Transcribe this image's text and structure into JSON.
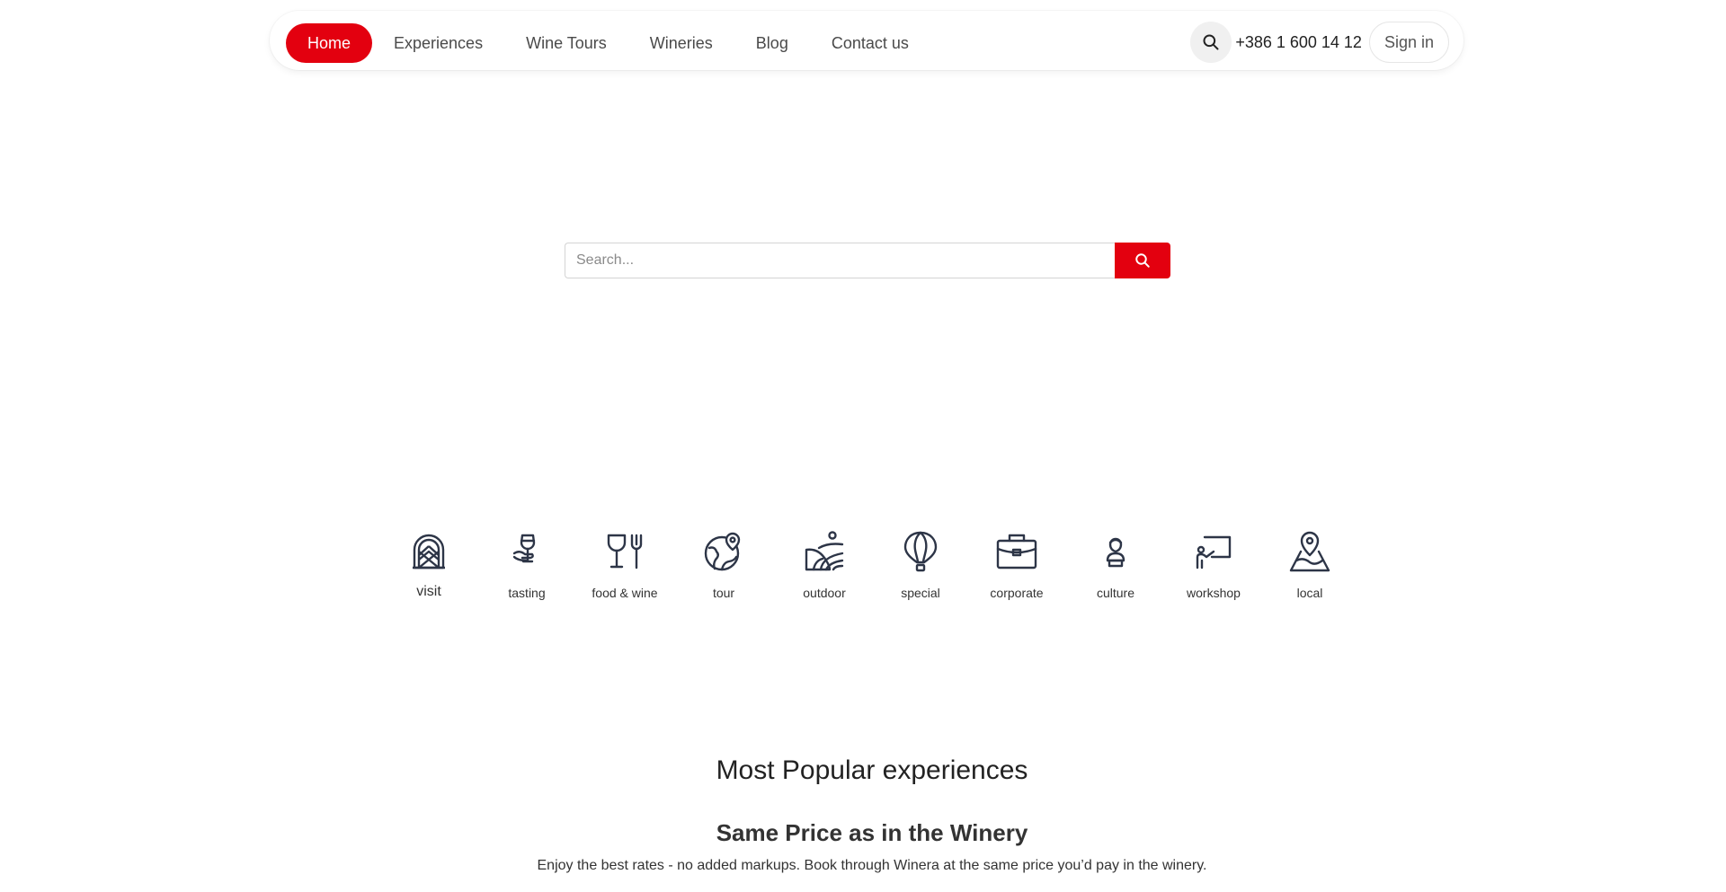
{
  "nav": {
    "links": [
      "Home",
      "Experiences",
      "Wine Tours",
      "Wineries",
      "Blog",
      "Contact us"
    ],
    "active": "Home",
    "phone": "+386 1 600 14 12",
    "sign_in": "Sign in",
    "search_icon": "search-icon"
  },
  "search": {
    "placeholder": "Search...",
    "value": "",
    "button_icon": "search-icon"
  },
  "categories": [
    {
      "label": "visit",
      "icon": "arch-door-icon"
    },
    {
      "label": "tasting",
      "icon": "wine-glass-hand-icon"
    },
    {
      "label": "food & wine",
      "icon": "glass-fork-icon"
    },
    {
      "label": "tour",
      "icon": "globe-pin-icon"
    },
    {
      "label": "outdoor",
      "icon": "vineyard-field-icon"
    },
    {
      "label": "special",
      "icon": "hot-air-balloon-icon"
    },
    {
      "label": "corporate",
      "icon": "briefcase-icon"
    },
    {
      "label": "culture",
      "icon": "bust-statue-icon"
    },
    {
      "label": "workshop",
      "icon": "presentation-board-icon"
    },
    {
      "label": "local",
      "icon": "map-pin-icon"
    }
  ],
  "popular": {
    "title": "Most Popular experiences",
    "subtitle": "Same Price as in the Winery",
    "text": "Enjoy the best rates - no added markups. Book through Winera at the same price you’d pay in the winery."
  },
  "colors": {
    "accent": "#e3000f",
    "icon": "#2d3547"
  }
}
